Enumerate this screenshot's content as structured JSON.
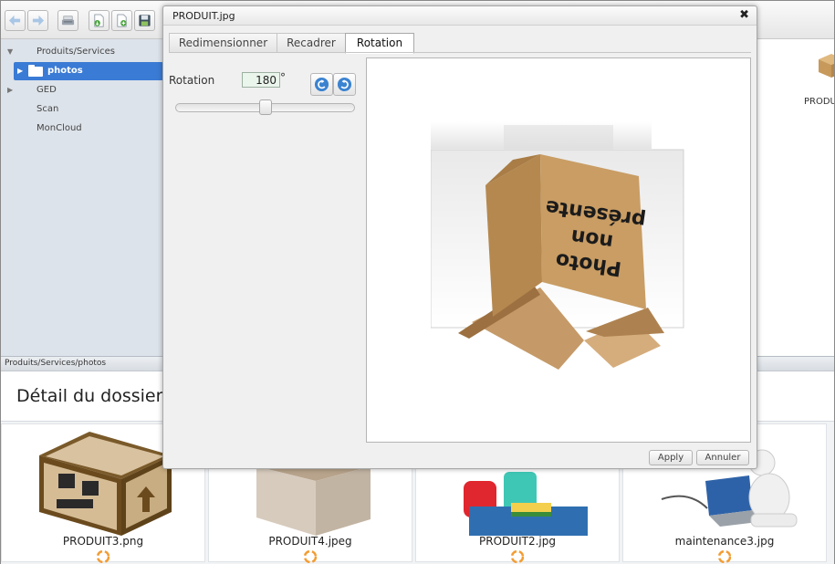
{
  "toolbar": {
    "buttons": [
      {
        "name": "back-button",
        "icon": "arrow-left-icon"
      },
      {
        "name": "forward-button",
        "icon": "arrow-right-icon"
      },
      {
        "name": "scanner-button",
        "icon": "scanner-icon"
      },
      {
        "name": "import-button",
        "icon": "document-import-icon"
      },
      {
        "name": "new-document-button",
        "icon": "document-add-icon"
      },
      {
        "name": "save-button",
        "icon": "floppy-disk-icon"
      }
    ]
  },
  "sidebar": {
    "items": [
      {
        "label": "Produits/Services",
        "expanded": true
      },
      {
        "label": "photos",
        "selected": true
      },
      {
        "label": "GED",
        "expanded": false
      },
      {
        "label": "Scan"
      },
      {
        "label": "MonCloud"
      }
    ]
  },
  "right_file": {
    "label": "PRODUI"
  },
  "pathbar": {
    "text": "Produits/Services/photos"
  },
  "detail": {
    "title": "Détail du dossier p"
  },
  "thumbnails": [
    {
      "name": "PRODUIT3.png"
    },
    {
      "name": "PRODUIT4.jpeg"
    },
    {
      "name": "PRODUIT2.jpg"
    },
    {
      "name": "maintenance3.jpg"
    }
  ],
  "dialog": {
    "title": "PRODUIT.jpg",
    "close": "✖",
    "tabs": [
      {
        "label": "Redimensionner",
        "active": false
      },
      {
        "label": "Recadrer",
        "active": false
      },
      {
        "label": "Rotation",
        "active": true
      }
    ],
    "rotation": {
      "label": "Rotation",
      "value": "180",
      "unit": "°",
      "slider_fraction": 0.5
    },
    "preview": {
      "box_text_line1": "Photo",
      "box_text_line2": "non",
      "box_text_line3": "présente"
    },
    "apply_label": "Apply",
    "cancel_label": "Annuler"
  },
  "colors": {
    "selection": "#3a7bd5",
    "sidebar_bg": "#dde3ea",
    "dialog_bg": "#f0f0f0"
  }
}
